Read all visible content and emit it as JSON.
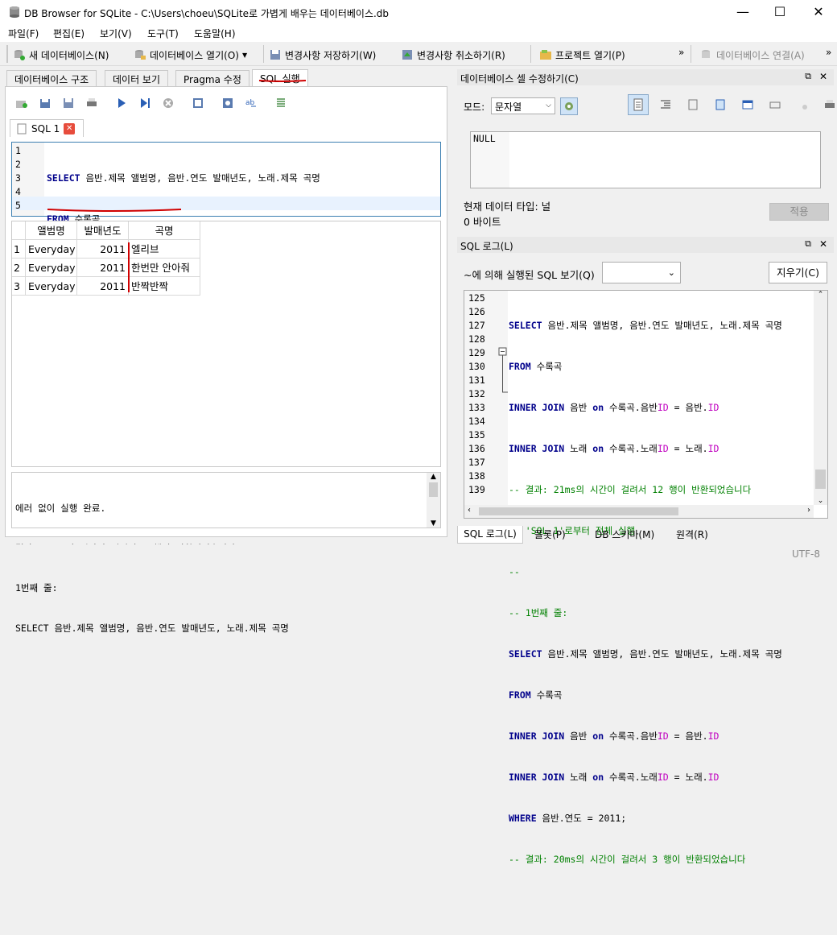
{
  "window": {
    "title": "DB Browser for SQLite - C:\\Users\\choeu\\SQLite로 가볍게 배우는 데이터베이스.db"
  },
  "menu": [
    "파일(F)",
    "편집(E)",
    "보기(V)",
    "도구(T)",
    "도움말(H)"
  ],
  "toolbar": {
    "new_db": "새 데이터베이스(N)",
    "open_db": "데이터베이스 열기(O)",
    "write_changes": "변경사항 저장하기(W)",
    "revert_changes": "변경사항 취소하기(R)",
    "open_project": "프로젝트 열기(P)",
    "attach_db": "데이터베이스 연결(A)",
    "more": "»"
  },
  "tabs": [
    "데이터베이스 구조",
    "데이터 보기",
    "Pragma 수정",
    "SQL 실행"
  ],
  "editor": {
    "tab_label": "SQL 1",
    "lines": [
      "1",
      "2",
      "3",
      "4",
      "5"
    ]
  },
  "results": {
    "columns": [
      "앨범명",
      "발매년도",
      "곡명"
    ],
    "rows": [
      {
        "num": "1",
        "album": "Everyday",
        "year": "2011",
        "song": "엘리브"
      },
      {
        "num": "2",
        "album": "Everyday",
        "year": "2011",
        "song": "한번만 안아줘"
      },
      {
        "num": "3",
        "album": "Everyday",
        "year": "2011",
        "song": "반짝반짝"
      }
    ]
  },
  "messages": [
    "에러 없이 실행 완료.",
    "결과: 20ms의 시간이 걸려서 3 행이 반환되었습니다",
    "1번째 줄:",
    "SELECT 음반.제목 앨범명, 음반.연도 발매년도, 노래.제목 곡명"
  ],
  "cell_edit": {
    "title": "데이터베이스 셀 수정하기(C)",
    "mode_label": "모드:",
    "mode_value": "문자열",
    "value": "NULL",
    "type_label": "현재 데이터 타입: 널",
    "size_label": "0 바이트",
    "apply": "적용"
  },
  "sql_log": {
    "title": "SQL 로그(L)",
    "submitted_label": "~에 의해 실행된 SQL 보기(Q)",
    "clear": "지우기(C)",
    "line_numbers": [
      "125",
      "126",
      "127",
      "128",
      "129",
      "130",
      "131",
      "132",
      "133",
      "134",
      "135",
      "136",
      "137",
      "138",
      "139"
    ]
  },
  "bottom_tabs": [
    "SQL 로그(L)",
    "플롯(P)",
    "DB 스키마(M)",
    "원격(R)"
  ],
  "status": {
    "encoding": "UTF-8"
  },
  "colors": {
    "keyword": "#00008b",
    "identifier": "#c000c0",
    "number": "#8b0000",
    "comment": "#008000",
    "annotation": "#d00000"
  }
}
